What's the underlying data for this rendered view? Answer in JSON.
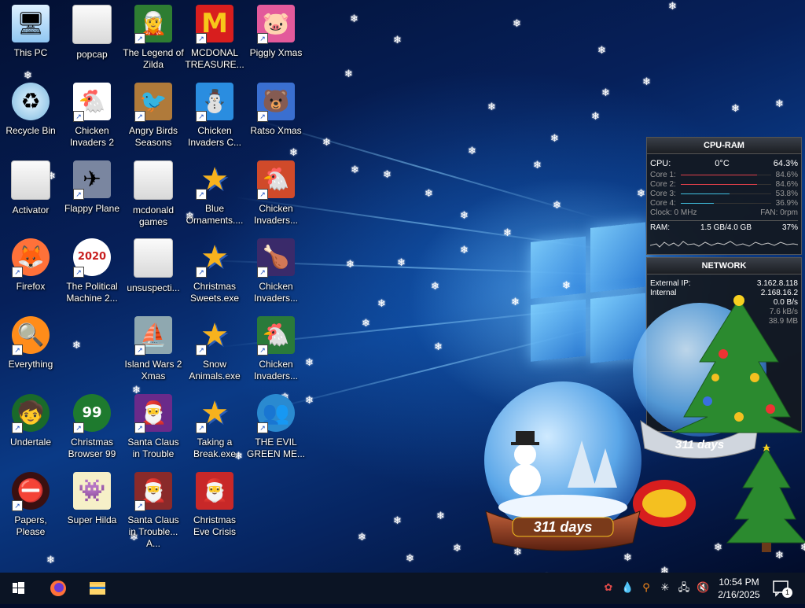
{
  "desktop": {
    "icons": [
      {
        "label": "This PC",
        "glyph": "🖥",
        "type": "pc",
        "shortcut": false
      },
      {
        "label": "popcap",
        "glyph": "",
        "type": "folder",
        "shortcut": false
      },
      {
        "label": "The Legend of Zilda",
        "glyph": "🧝",
        "type": "game",
        "shortcut": true,
        "color": "#2e7d32"
      },
      {
        "label": "MCDONAL TREASURE...",
        "glyph": "M",
        "type": "game",
        "shortcut": true,
        "color": "#d81e1e"
      },
      {
        "label": "Piggly Xmas",
        "glyph": "🐷",
        "type": "game",
        "shortcut": true,
        "color": "#e35a9b"
      },
      {
        "label": "Recycle Bin",
        "glyph": "♻",
        "type": "bin",
        "shortcut": false
      },
      {
        "label": "Chicken Invaders 2",
        "glyph": "🐔",
        "type": "game",
        "shortcut": true,
        "color": "#ffffff"
      },
      {
        "label": "Angry Birds Seasons",
        "glyph": "🐦",
        "type": "game",
        "shortcut": true,
        "color": "#b07a3a"
      },
      {
        "label": "Chicken Invaders C...",
        "glyph": "⛄",
        "type": "game",
        "shortcut": true,
        "color": "#2a8de0"
      },
      {
        "label": "Ratso Xmas",
        "glyph": "🐻",
        "type": "game",
        "shortcut": true,
        "color": "#3a6fd0"
      },
      {
        "label": "Activator",
        "glyph": "",
        "type": "folder",
        "shortcut": false
      },
      {
        "label": "Flappy Plane",
        "glyph": "✈",
        "type": "game",
        "shortcut": true,
        "color": "#7a86a0"
      },
      {
        "label": "mcdonald games",
        "glyph": "",
        "type": "folder",
        "shortcut": false
      },
      {
        "label": "Blue Ornaments....",
        "glyph": "★",
        "type": "star",
        "shortcut": true
      },
      {
        "label": "Chicken Invaders...",
        "glyph": "🐔",
        "type": "game",
        "shortcut": true,
        "color": "#d04a2a"
      },
      {
        "label": "Firefox",
        "glyph": "🦊",
        "type": "app",
        "shortcut": true,
        "color": "#ff7139"
      },
      {
        "label": "The Political Machine 2...",
        "glyph": "2020",
        "type": "app",
        "shortcut": true,
        "color": "#ffffff"
      },
      {
        "label": "unsuspecti...",
        "glyph": "",
        "type": "folder",
        "shortcut": false
      },
      {
        "label": "Christmas Sweets.exe",
        "glyph": "★",
        "type": "star",
        "shortcut": true
      },
      {
        "label": "Chicken Invaders...",
        "glyph": "🍗",
        "type": "game",
        "shortcut": true,
        "color": "#3a2a6a"
      },
      {
        "label": "Everything",
        "glyph": "🔍",
        "type": "app",
        "shortcut": true,
        "color": "#ff8c1a"
      },
      {
        "label": "Island Wars 2 Xmas",
        "glyph": "⛵",
        "type": "game",
        "shortcut": true,
        "color": "#8fa8b0"
      },
      {
        "label": "Snow Animals.exe",
        "glyph": "★",
        "type": "star",
        "shortcut": true
      },
      {
        "label": "Chicken Invaders...",
        "glyph": "🐔",
        "type": "game",
        "shortcut": true,
        "color": "#2a7a3a"
      },
      {
        "label": "Undertale",
        "glyph": "🧒",
        "type": "app",
        "shortcut": true,
        "color": "#1a6a2a"
      },
      {
        "label": "Christmas Browser 99",
        "glyph": "99",
        "type": "app",
        "shortcut": true,
        "color": "#1e7a2e"
      },
      {
        "label": "Santa Claus in Trouble",
        "glyph": "🎅",
        "type": "game",
        "shortcut": true,
        "color": "#6a2a8a"
      },
      {
        "label": "Taking a Break.exe",
        "glyph": "★",
        "type": "star",
        "shortcut": true
      },
      {
        "label": "THE EVIL GREEN ME...",
        "glyph": "👥",
        "type": "app",
        "shortcut": true,
        "color": "#2a8ad0"
      },
      {
        "label": "Papers, Please",
        "glyph": "⛔",
        "type": "app",
        "shortcut": true,
        "color": "#3a1010"
      },
      {
        "label": "Super Hilda",
        "glyph": "👾",
        "type": "game",
        "shortcut": false,
        "color": "#f6f0c8"
      },
      {
        "label": "Santa Claus in Trouble... A...",
        "glyph": "🎅",
        "type": "game",
        "shortcut": true,
        "color": "#8a2a2a"
      },
      {
        "label": "Christmas Eve Crisis",
        "glyph": "🎅",
        "type": "game",
        "shortcut": false,
        "color": "#c82828"
      }
    ]
  },
  "gadgets": {
    "cpuram": {
      "title": "CPU-RAM",
      "cpu_label": "CPU:",
      "cpu_temp": "0°C",
      "cpu_percent": "64.3%",
      "cores": [
        {
          "label": "Core 1:",
          "value": "84.6%",
          "level": 0.846,
          "color": "#e0404a"
        },
        {
          "label": "Core 2:",
          "value": "84.6%",
          "level": 0.846,
          "color": "#e0404a"
        },
        {
          "label": "Core 3:",
          "value": "53.8%",
          "level": 0.538,
          "color": "#40c0e0"
        },
        {
          "label": "Core 4:",
          "value": "36.9%",
          "level": 0.369,
          "color": "#40c0e0"
        }
      ],
      "clock": "Clock: 0 MHz",
      "fan": "FAN: 0rpm",
      "ram_label": "RAM:",
      "ram_value": "1.5 GB/4.0 GB",
      "ram_percent": "37%"
    },
    "network": {
      "title": "NETWORK",
      "external_label": "External IP:",
      "external_value": "3.162.8.118",
      "internal_label": "Internal",
      "internal_value": "2.168.16.2",
      "rows": [
        "0.0 B/s",
        "7.6 kB/s",
        "38.9 MB"
      ]
    },
    "snowglobe": {
      "days_text": "311 days"
    }
  },
  "taskbar": {
    "time": "10:54 PM",
    "date": "2/16/2025",
    "notification_count": "1"
  },
  "colors": {
    "taskbar": "#0b1424",
    "accent": "#1a4fbf"
  }
}
